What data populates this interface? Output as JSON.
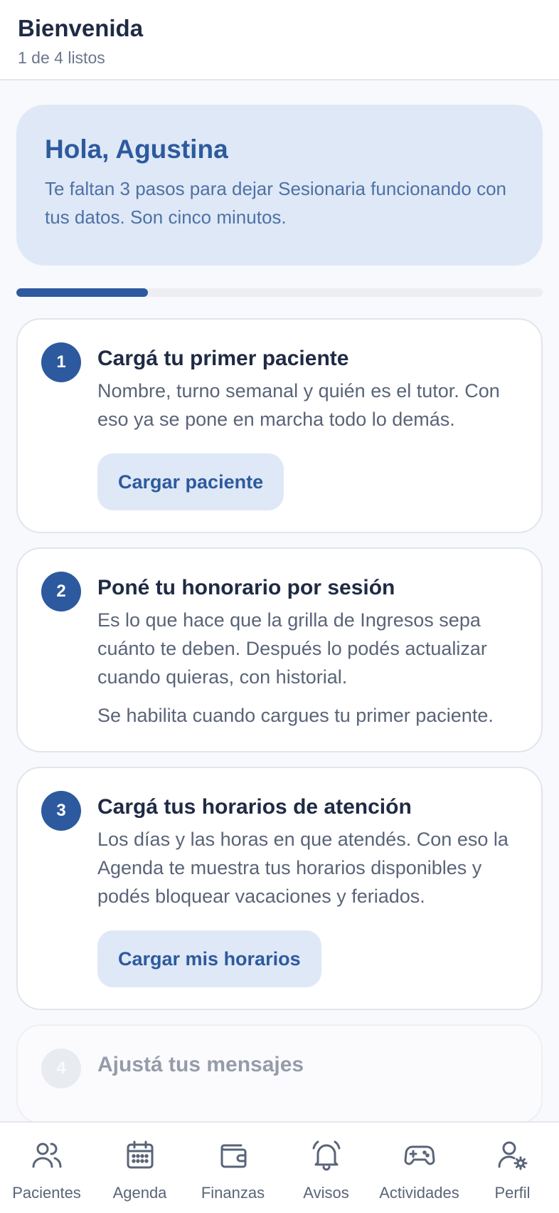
{
  "header": {
    "title": "Bienvenida",
    "subtitle": "1 de 4 listos"
  },
  "hero": {
    "title": "Hola, Agustina",
    "text": "Te faltan 3 pasos para dejar Sesionaria funcionando con tus datos. Son cinco minutos."
  },
  "progress": {
    "value": 0.25
  },
  "steps": [
    {
      "number": "1",
      "title": "Cargá tu primer paciente",
      "description": "Nombre, turno semanal y quién es el tutor. Con eso ya se pone en marcha todo lo demás.",
      "button": "Cargar paciente"
    },
    {
      "number": "2",
      "title": "Poné tu honorario por sesión",
      "description": "Es lo que hace que la grilla de Ingresos sepa cuánto te deben. Después lo podés actualizar cuando quieras, con historial.",
      "note": "Se habilita cuando cargues tu primer paciente."
    },
    {
      "number": "3",
      "title": "Cargá tus horarios de atención",
      "description": "Los días y las horas en que atendés. Con eso la Agenda te muestra tus horarios disponibles y podés bloquear vacaciones y feriados.",
      "button": "Cargar mis horarios"
    },
    {
      "number": "4",
      "title": "Ajustá tus mensajes"
    }
  ],
  "nav": {
    "items": [
      {
        "label": "Pacientes",
        "icon": "users-icon"
      },
      {
        "label": "Agenda",
        "icon": "calendar-icon"
      },
      {
        "label": "Finanzas",
        "icon": "wallet-icon"
      },
      {
        "label": "Avisos",
        "icon": "bell-icon"
      },
      {
        "label": "Actividades",
        "icon": "gamepad-icon"
      },
      {
        "label": "Perfil",
        "icon": "user-settings-icon"
      }
    ]
  },
  "colors": {
    "accent": "#2d5a9e",
    "accent_soft": "#dfe8f6",
    "text": "#1f2a44",
    "muted": "#5a6478"
  }
}
